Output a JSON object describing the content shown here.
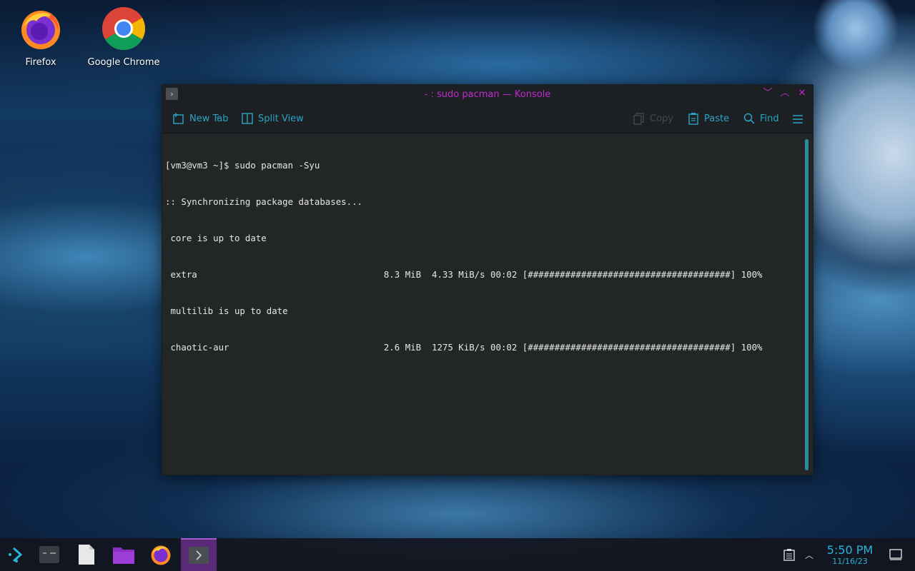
{
  "desktop": {
    "icons": [
      {
        "label": "Firefox"
      },
      {
        "label": "Google Chrome"
      }
    ]
  },
  "window": {
    "title": "- : sudo pacman — Konsole",
    "title_color": "#c02ad0",
    "toolbar": {
      "new_tab": "New Tab",
      "split_view": "Split View",
      "copy": "Copy",
      "paste": "Paste",
      "find": "Find"
    },
    "accent": "#29a3c4"
  },
  "terminal": {
    "lines": [
      "[vm3@vm3 ~]$ sudo pacman -Syu",
      ":: Synchronizing package databases...",
      " core is up to date",
      " extra                                   8.3 MiB  4.33 MiB/s 00:02 [######################################] 100%",
      " multilib is up to date",
      " chaotic-aur                             2.6 MiB  1275 KiB/s 00:02 [######################################] 100%"
    ]
  },
  "taskbar": {
    "time": "5:50 PM",
    "date": "11/16/23"
  }
}
